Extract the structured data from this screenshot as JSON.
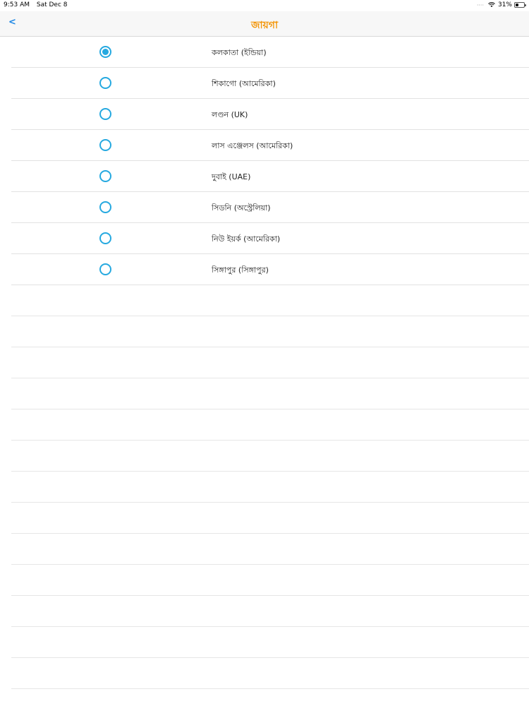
{
  "status": {
    "time": "9:53 AM",
    "date": "Sat Dec 8",
    "signal": "····",
    "battery_pct": "31%"
  },
  "nav": {
    "back_label": "<",
    "title": "জায়গা"
  },
  "locations": [
    {
      "label": "কলকাতা (ইন্ডিয়া)",
      "selected": true
    },
    {
      "label": "শিকাগো (আমেরিকা)",
      "selected": false
    },
    {
      "label": "লণ্ডন (UK)",
      "selected": false
    },
    {
      "label": "লাস এঞ্জেলস (আমেরিকা)",
      "selected": false
    },
    {
      "label": "দুবাই (UAE)",
      "selected": false
    },
    {
      "label": "সিডনি (অস্ট্রেলিয়া)",
      "selected": false
    },
    {
      "label": "নিউ ইয়র্ক (আমেরিকা)",
      "selected": false
    },
    {
      "label": "সিঙ্গাপুর (সিঙ্গাপুর)",
      "selected": false
    }
  ],
  "empty_rows": 13,
  "colors": {
    "accent": "#26a9e0",
    "title": "#f39200",
    "back": "#1e88e5"
  }
}
